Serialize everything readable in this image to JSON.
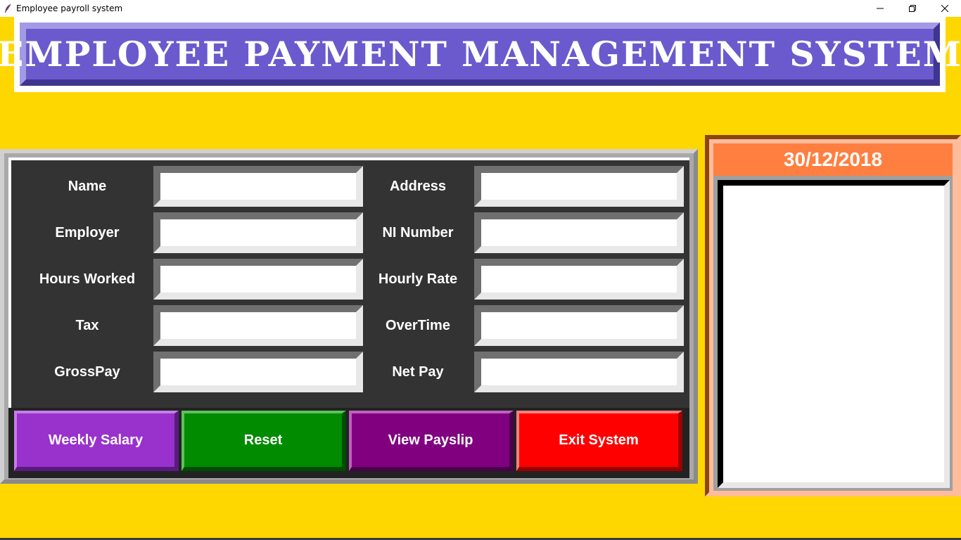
{
  "window": {
    "title": "Employee payroll system",
    "icon": "feather-icon",
    "controls": [
      "minimize-icon",
      "restore-icon",
      "close-icon"
    ]
  },
  "banner": {
    "title": "EMPLOYEE PAYMENT MANAGEMENT SYSTEM"
  },
  "form": {
    "rows": [
      {
        "left_label": "Name",
        "left_value": "",
        "right_label": "Address",
        "right_value": ""
      },
      {
        "left_label": "Employer",
        "left_value": "",
        "right_label": "NI Number",
        "right_value": ""
      },
      {
        "left_label": "Hours Worked",
        "left_value": "",
        "right_label": "Hourly Rate",
        "right_value": ""
      },
      {
        "left_label": "Tax",
        "left_value": "",
        "right_label": "OverTime",
        "right_value": ""
      },
      {
        "left_label": "GrossPay",
        "left_value": "",
        "right_label": "Net Pay",
        "right_value": ""
      }
    ]
  },
  "buttons": [
    {
      "label": "Weekly Salary",
      "color": "#9932cc"
    },
    {
      "label": "Reset",
      "color": "#008b00"
    },
    {
      "label": "View Payslip",
      "color": "#800080"
    },
    {
      "label": "Exit System",
      "color": "#ff0000"
    }
  ],
  "side": {
    "date": "30/12/2018",
    "receipt_text": ""
  },
  "colors": {
    "background": "#ffd700",
    "banner": "#6a5acd",
    "form_bg": "#333333",
    "date_bar": "#ff7f40"
  }
}
